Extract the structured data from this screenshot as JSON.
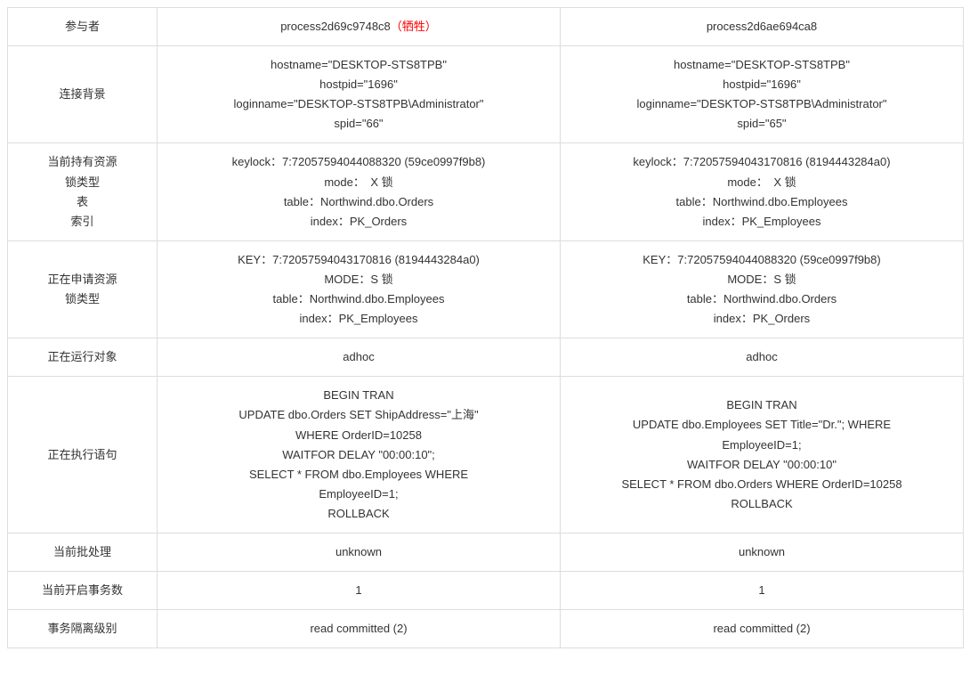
{
  "rows": {
    "participant": {
      "label": "参与者",
      "col1_main": "process2d69c9748c8",
      "col1_victim": "（牺牲）",
      "col2": "process2d6ae694ca8"
    },
    "conn_background": {
      "label": "连接背景",
      "col1": "hostname=\"DESKTOP-STS8TPB\"\nhostpid=\"1696\"\nloginname=\"DESKTOP-STS8TPB\\Administrator\"\nspid=\"66\"",
      "col2": "hostname=\"DESKTOP-STS8TPB\"\nhostpid=\"1696\"\nloginname=\"DESKTOP-STS8TPB\\Administrator\"\nspid=\"65\""
    },
    "held_resource": {
      "label": "当前持有资源\n锁类型\n表\n索引",
      "col1": "keylock：7:72057594044088320 (59ce0997f9b8)\nmode：　X 锁\ntable：Northwind.dbo.Orders\nindex：PK_Orders",
      "col2": "keylock：7:72057594043170816 (8194443284a0)\nmode：　X 锁\ntable：Northwind.dbo.Employees\nindex：PK_Employees"
    },
    "request_resource": {
      "label": "正在申请资源\n锁类型",
      "col1": "KEY：7:72057594043170816 (8194443284a0)\nMODE：S 锁\ntable：Northwind.dbo.Employees\nindex：PK_Employees",
      "col2": "KEY：7:72057594044088320 (59ce0997f9b8)\nMODE：S 锁\ntable：Northwind.dbo.Orders\nindex：PK_Orders"
    },
    "running_obj": {
      "label": "正在运行对象",
      "col1": "adhoc",
      "col2": "adhoc"
    },
    "exec_stmt": {
      "label": "正在执行语句",
      "col1": "BEGIN TRAN\nUPDATE  dbo.Orders SET  ShipAddress=\"上海\"\nWHERE OrderID=10258\nWAITFOR DELAY \"00:00:10\";\nSELECT * FROM dbo.Employees WHERE\nEmployeeID=1;\nROLLBACK",
      "col2": "BEGIN TRAN\nUPDATE dbo.Employees SET Title=\"Dr.\"; WHERE\nEmployeeID=1;\nWAITFOR DELAY \"00:00:10\"\nSELECT * FROM dbo.Orders WHERE OrderID=10258\nROLLBACK"
    },
    "current_batch": {
      "label": "当前批处理",
      "col1": "unknown",
      "col2": "unknown"
    },
    "open_tran_count": {
      "label": "当前开启事务数",
      "col1": "1",
      "col2": "1"
    },
    "isolation_level": {
      "label": "事务隔离级别",
      "col1": "read committed (2)",
      "col2": "read committed (2)"
    }
  }
}
